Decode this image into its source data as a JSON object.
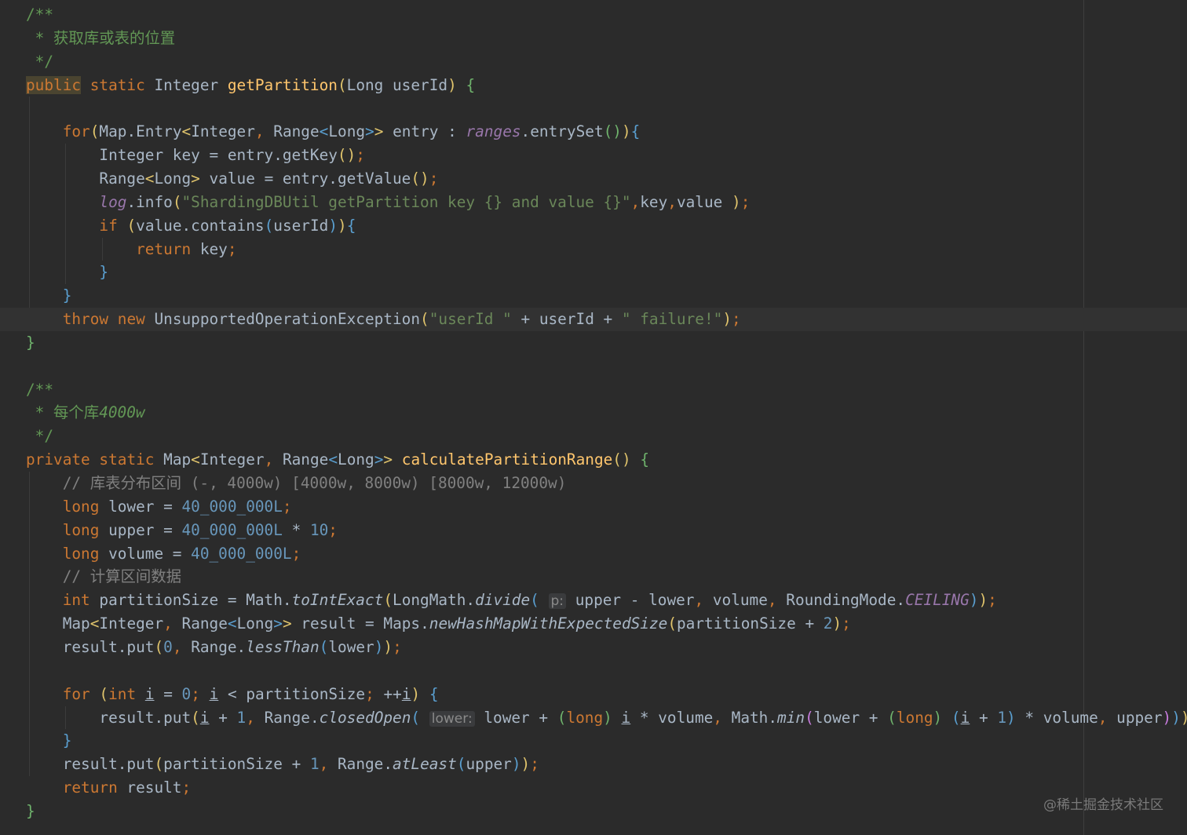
{
  "editor": {
    "lines": [
      [
        {
          "t": "/**",
          "c": "doc"
        }
      ],
      [
        {
          "t": " * 获取库或表的位置",
          "c": "doc"
        }
      ],
      [
        {
          "t": " */",
          "c": "doc"
        }
      ],
      [
        {
          "t": "public",
          "c": "kw hl"
        },
        {
          "t": " "
        },
        {
          "t": "static",
          "c": "kw"
        },
        {
          "t": " Integer "
        },
        {
          "t": "getPartition",
          "c": "fn"
        },
        {
          "t": "(",
          "c": "b1"
        },
        {
          "t": "Long userId"
        },
        {
          "t": ")",
          "c": "b1"
        },
        {
          "t": " "
        },
        {
          "t": "{",
          "c": "b3"
        }
      ],
      [],
      [
        {
          "t": "    "
        },
        {
          "t": "for",
          "c": "kw"
        },
        {
          "t": "(",
          "c": "b1"
        },
        {
          "t": "Map.Entry"
        },
        {
          "t": "<",
          "c": "b1"
        },
        {
          "t": "Integer"
        },
        {
          "t": ",",
          "c": "kw"
        },
        {
          "t": " Range"
        },
        {
          "t": "<",
          "c": "b2"
        },
        {
          "t": "Long"
        },
        {
          "t": ">",
          "c": "b2"
        },
        {
          "t": ">",
          "c": "b1"
        },
        {
          "t": " entry : "
        },
        {
          "t": "ranges",
          "c": "fld"
        },
        {
          "t": ".entrySet"
        },
        {
          "t": "()",
          "c": "b3"
        },
        {
          "t": ")",
          "c": "b1"
        },
        {
          "t": "{",
          "c": "b2"
        }
      ],
      [
        {
          "t": "        Integer key = entry.getKey"
        },
        {
          "t": "()",
          "c": "b1"
        },
        {
          "t": ";",
          "c": "kw"
        }
      ],
      [
        {
          "t": "        Range"
        },
        {
          "t": "<",
          "c": "b1"
        },
        {
          "t": "Long"
        },
        {
          "t": ">",
          "c": "b1"
        },
        {
          "t": " value = entry.getValue"
        },
        {
          "t": "()",
          "c": "b1"
        },
        {
          "t": ";",
          "c": "kw"
        }
      ],
      [
        {
          "t": "        "
        },
        {
          "t": "log",
          "c": "fld"
        },
        {
          "t": ".info"
        },
        {
          "t": "(",
          "c": "b1"
        },
        {
          "t": "\"ShardingDBUtil getPartition key {} and value {}\"",
          "c": "str"
        },
        {
          "t": ",",
          "c": "kw"
        },
        {
          "t": "key"
        },
        {
          "t": ",",
          "c": "kw"
        },
        {
          "t": "value "
        },
        {
          "t": ")",
          "c": "b1"
        },
        {
          "t": ";",
          "c": "kw"
        }
      ],
      [
        {
          "t": "        "
        },
        {
          "t": "if",
          "c": "kw"
        },
        {
          "t": " "
        },
        {
          "t": "(",
          "c": "b1"
        },
        {
          "t": "value.contains"
        },
        {
          "t": "(",
          "c": "b2"
        },
        {
          "t": "userId"
        },
        {
          "t": ")",
          "c": "b2"
        },
        {
          "t": ")",
          "c": "b1"
        },
        {
          "t": "{",
          "c": "b2"
        }
      ],
      [
        {
          "t": "            "
        },
        {
          "t": "return",
          "c": "kw"
        },
        {
          "t": " key"
        },
        {
          "t": ";",
          "c": "kw"
        }
      ],
      [
        {
          "t": "        "
        },
        {
          "t": "}",
          "c": "b2"
        }
      ],
      [
        {
          "t": "    "
        },
        {
          "t": "}",
          "c": "b2"
        }
      ],
      [
        {
          "t": "    "
        },
        {
          "t": "throw",
          "c": "kw"
        },
        {
          "t": " "
        },
        {
          "t": "new",
          "c": "kw"
        },
        {
          "t": " UnsupportedOperationException"
        },
        {
          "t": "(",
          "c": "b1"
        },
        {
          "t": "\"userId \"",
          "c": "str"
        },
        {
          "t": " + userId + "
        },
        {
          "t": "\" failure!\"",
          "c": "str"
        },
        {
          "t": ")",
          "c": "b1"
        },
        {
          "t": ";",
          "c": "kw"
        }
      ],
      [
        {
          "t": "}",
          "c": "b3"
        }
      ],
      [],
      [
        {
          "t": "/**",
          "c": "doc"
        }
      ],
      [
        {
          "t": " * 每个库",
          "c": "doc"
        },
        {
          "t": "4000w",
          "c": "docit"
        }
      ],
      [
        {
          "t": " */",
          "c": "doc"
        }
      ],
      [
        {
          "t": "private",
          "c": "kw"
        },
        {
          "t": " "
        },
        {
          "t": "static",
          "c": "kw"
        },
        {
          "t": " Map"
        },
        {
          "t": "<",
          "c": "b1"
        },
        {
          "t": "Integer"
        },
        {
          "t": ",",
          "c": "kw"
        },
        {
          "t": " Range"
        },
        {
          "t": "<",
          "c": "b2"
        },
        {
          "t": "Long"
        },
        {
          "t": ">",
          "c": "b2"
        },
        {
          "t": ">",
          "c": "b1"
        },
        {
          "t": " "
        },
        {
          "t": "calculatePartitionRange",
          "c": "fn"
        },
        {
          "t": "()",
          "c": "b1"
        },
        {
          "t": " "
        },
        {
          "t": "{",
          "c": "b3"
        }
      ],
      [
        {
          "t": "    // 库表分布区间 (-, 4000w) [4000w, 8000w) [8000w, 12000w)",
          "c": "cm"
        }
      ],
      [
        {
          "t": "    "
        },
        {
          "t": "long",
          "c": "kw"
        },
        {
          "t": " lower = "
        },
        {
          "t": "40_000_000L",
          "c": "num"
        },
        {
          "t": ";",
          "c": "kw"
        }
      ],
      [
        {
          "t": "    "
        },
        {
          "t": "long",
          "c": "kw"
        },
        {
          "t": " upper = "
        },
        {
          "t": "40_000_000L",
          "c": "num"
        },
        {
          "t": " * "
        },
        {
          "t": "10",
          "c": "num"
        },
        {
          "t": ";",
          "c": "kw"
        }
      ],
      [
        {
          "t": "    "
        },
        {
          "t": "long",
          "c": "kw"
        },
        {
          "t": " volume = "
        },
        {
          "t": "40_000_000L",
          "c": "num"
        },
        {
          "t": ";",
          "c": "kw"
        }
      ],
      [
        {
          "t": "    // 计算区间数据",
          "c": "cm"
        }
      ],
      [
        {
          "t": "    "
        },
        {
          "t": "int",
          "c": "kw"
        },
        {
          "t": " partitionSize = Math."
        },
        {
          "t": "toIntExact",
          "c": "it"
        },
        {
          "t": "(",
          "c": "b1"
        },
        {
          "t": "LongMath."
        },
        {
          "t": "divide",
          "c": "it"
        },
        {
          "t": "(",
          "c": "b2"
        },
        {
          "t": " "
        },
        {
          "t": "p:",
          "c": "hint"
        },
        {
          "t": " upper - lower"
        },
        {
          "t": ",",
          "c": "kw"
        },
        {
          "t": " volume"
        },
        {
          "t": ",",
          "c": "kw"
        },
        {
          "t": " RoundingMode."
        },
        {
          "t": "CEILING",
          "c": "cst"
        },
        {
          "t": ")",
          "c": "b2"
        },
        {
          "t": ")",
          "c": "b1"
        },
        {
          "t": ";",
          "c": "kw"
        }
      ],
      [
        {
          "t": "    Map"
        },
        {
          "t": "<",
          "c": "b1"
        },
        {
          "t": "Integer"
        },
        {
          "t": ",",
          "c": "kw"
        },
        {
          "t": " Range"
        },
        {
          "t": "<",
          "c": "b2"
        },
        {
          "t": "Long"
        },
        {
          "t": ">",
          "c": "b2"
        },
        {
          "t": ">",
          "c": "b1"
        },
        {
          "t": " result = Maps."
        },
        {
          "t": "newHashMapWithExpectedSize",
          "c": "it"
        },
        {
          "t": "(",
          "c": "b1"
        },
        {
          "t": "partitionSize + "
        },
        {
          "t": "2",
          "c": "num"
        },
        {
          "t": ")",
          "c": "b1"
        },
        {
          "t": ";",
          "c": "kw"
        }
      ],
      [
        {
          "t": "    result.put"
        },
        {
          "t": "(",
          "c": "b1"
        },
        {
          "t": "0",
          "c": "num"
        },
        {
          "t": ",",
          "c": "kw"
        },
        {
          "t": " Range."
        },
        {
          "t": "lessThan",
          "c": "it"
        },
        {
          "t": "(",
          "c": "b2"
        },
        {
          "t": "lower"
        },
        {
          "t": ")",
          "c": "b2"
        },
        {
          "t": ")",
          "c": "b1"
        },
        {
          "t": ";",
          "c": "kw"
        }
      ],
      [],
      [
        {
          "t": "    "
        },
        {
          "t": "for",
          "c": "kw"
        },
        {
          "t": " "
        },
        {
          "t": "(",
          "c": "b1"
        },
        {
          "t": "int",
          "c": "kw"
        },
        {
          "t": " "
        },
        {
          "t": "i",
          "c": "ul"
        },
        {
          "t": " = "
        },
        {
          "t": "0",
          "c": "num"
        },
        {
          "t": ";",
          "c": "kw"
        },
        {
          "t": " "
        },
        {
          "t": "i",
          "c": "ul"
        },
        {
          "t": " < partitionSize"
        },
        {
          "t": ";",
          "c": "kw"
        },
        {
          "t": " ++"
        },
        {
          "t": "i",
          "c": "ul"
        },
        {
          "t": ")",
          "c": "b1"
        },
        {
          "t": " "
        },
        {
          "t": "{",
          "c": "b2"
        }
      ],
      [
        {
          "t": "        result.put"
        },
        {
          "t": "(",
          "c": "b1"
        },
        {
          "t": "i",
          "c": "ul"
        },
        {
          "t": " + "
        },
        {
          "t": "1",
          "c": "num"
        },
        {
          "t": ",",
          "c": "kw"
        },
        {
          "t": " Range."
        },
        {
          "t": "closedOpen",
          "c": "it"
        },
        {
          "t": "(",
          "c": "b2"
        },
        {
          "t": " "
        },
        {
          "t": "lower:",
          "c": "hint"
        },
        {
          "t": " lower + "
        },
        {
          "t": "(",
          "c": "b3"
        },
        {
          "t": "long",
          "c": "kw"
        },
        {
          "t": ")",
          "c": "b3"
        },
        {
          "t": " "
        },
        {
          "t": "i",
          "c": "ul"
        },
        {
          "t": " * volume"
        },
        {
          "t": ",",
          "c": "kw"
        },
        {
          "t": " Math."
        },
        {
          "t": "min",
          "c": "it"
        },
        {
          "t": "(",
          "c": "b4"
        },
        {
          "t": "lower + "
        },
        {
          "t": "(",
          "c": "b3"
        },
        {
          "t": "long",
          "c": "kw"
        },
        {
          "t": ")",
          "c": "b3"
        },
        {
          "t": " "
        },
        {
          "t": "(",
          "c": "b2"
        },
        {
          "t": "i",
          "c": "ul"
        },
        {
          "t": " + "
        },
        {
          "t": "1",
          "c": "num"
        },
        {
          "t": ")",
          "c": "b2"
        },
        {
          "t": " * volume"
        },
        {
          "t": ",",
          "c": "kw"
        },
        {
          "t": " upper"
        },
        {
          "t": ")",
          "c": "b4"
        },
        {
          "t": ")",
          "c": "b2"
        },
        {
          "t": ")",
          "c": "b1"
        },
        {
          "t": ";",
          "c": "kw"
        }
      ],
      [
        {
          "t": "    "
        },
        {
          "t": "}",
          "c": "b2"
        }
      ],
      [
        {
          "t": "    result.put"
        },
        {
          "t": "(",
          "c": "b1"
        },
        {
          "t": "partitionSize + "
        },
        {
          "t": "1",
          "c": "num"
        },
        {
          "t": ",",
          "c": "kw"
        },
        {
          "t": " Range."
        },
        {
          "t": "atLeast",
          "c": "it"
        },
        {
          "t": "(",
          "c": "b2"
        },
        {
          "t": "upper"
        },
        {
          "t": ")",
          "c": "b2"
        },
        {
          "t": ")",
          "c": "b1"
        },
        {
          "t": ";",
          "c": "kw"
        }
      ],
      [
        {
          "t": "    "
        },
        {
          "t": "return",
          "c": "kw"
        },
        {
          "t": " result"
        },
        {
          "t": ";",
          "c": "kw"
        }
      ],
      [
        {
          "t": "}",
          "c": "b3"
        }
      ]
    ],
    "current_line": 13
  },
  "watermark": "@稀土掘金技术社区"
}
